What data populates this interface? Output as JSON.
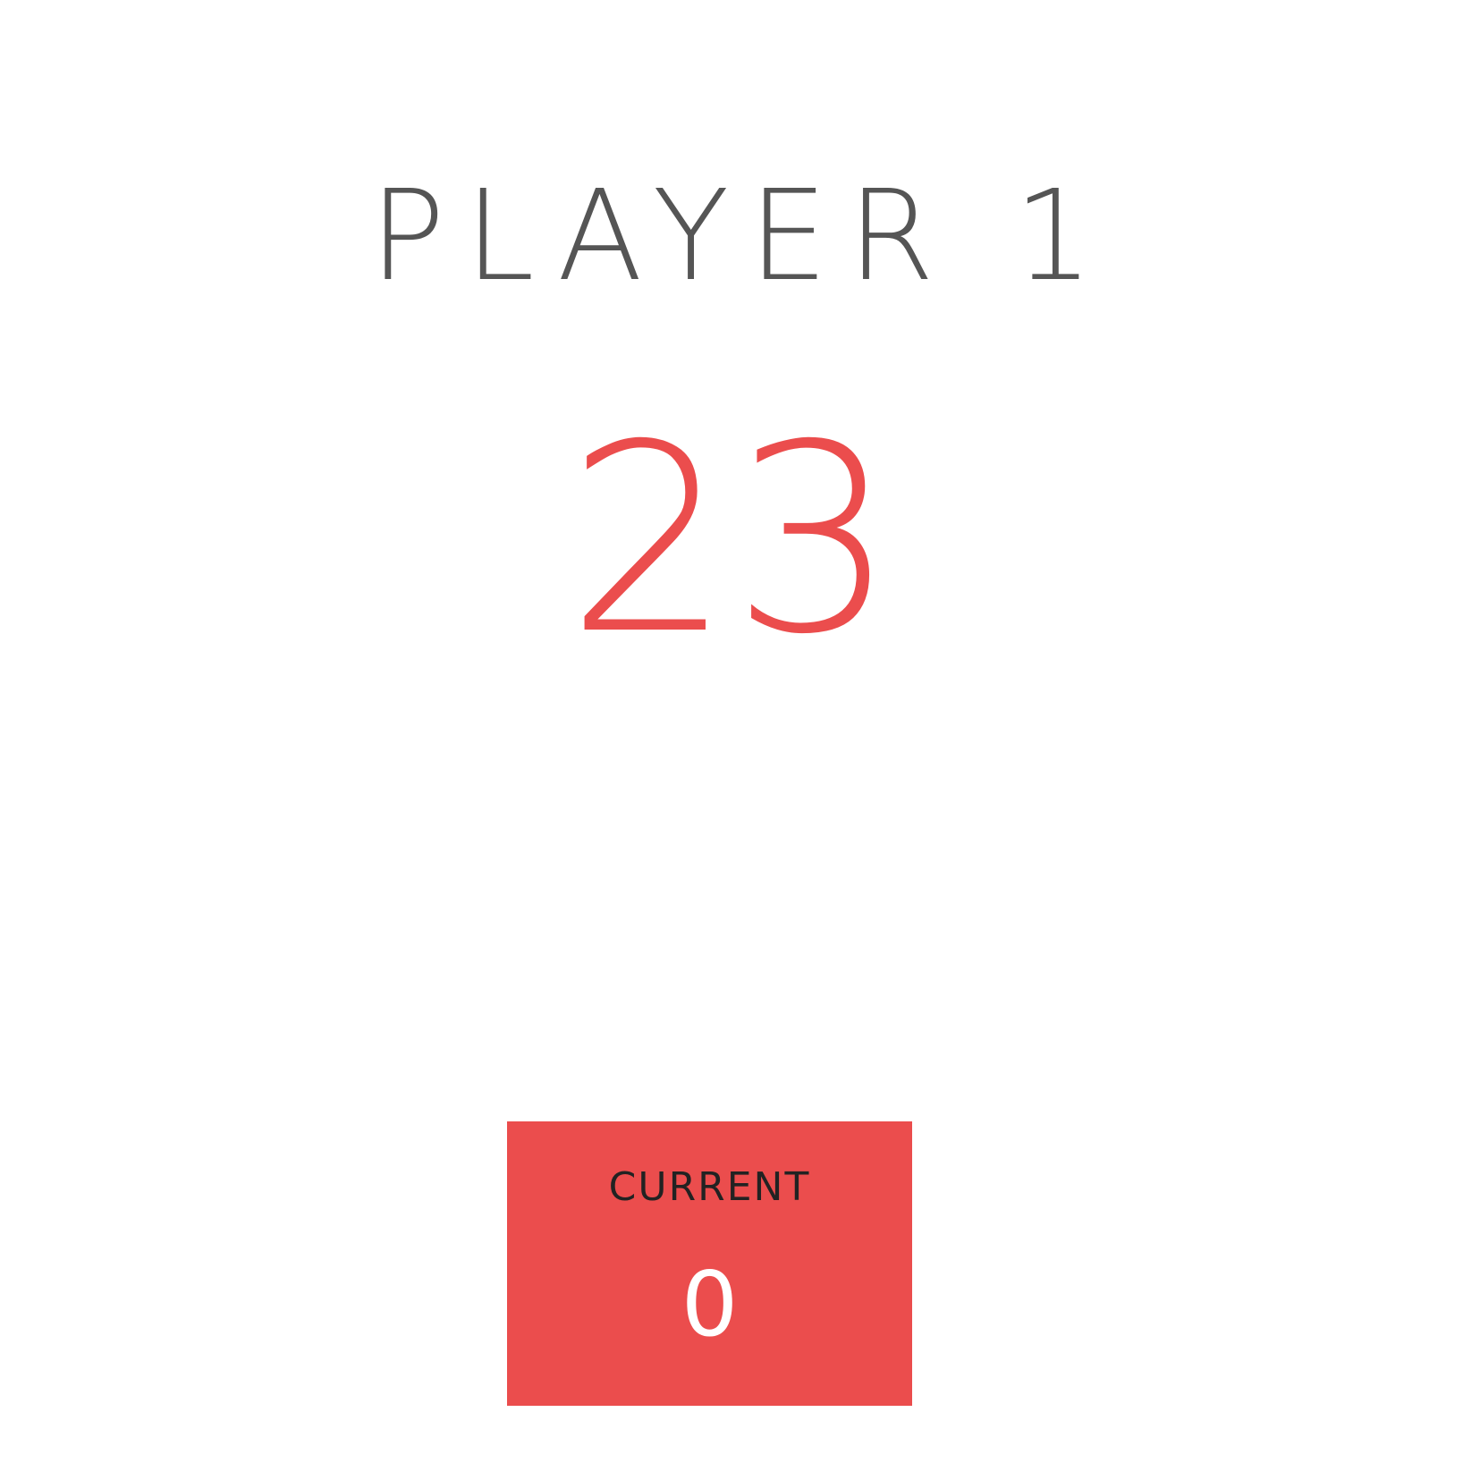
{
  "player": {
    "name": "PLAYER 1",
    "score": "23"
  },
  "current": {
    "label": "CURRENT",
    "score": "0"
  },
  "colors": {
    "accent": "#EB4D4D",
    "name_text": "#555555",
    "label_text": "#222222",
    "background": "#FFFFFF"
  }
}
